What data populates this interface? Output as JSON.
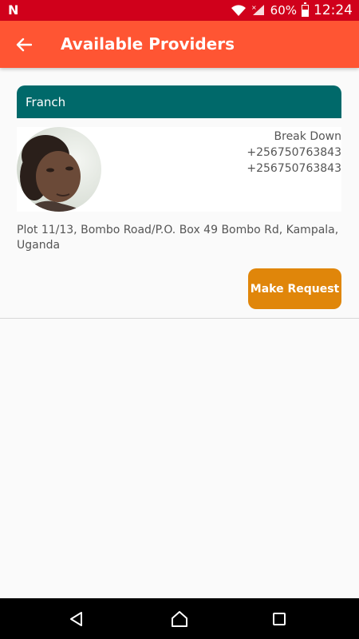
{
  "status_bar": {
    "notification_icon": "N",
    "battery_percent": "60%",
    "battery_level": 0.6,
    "time": "12:24"
  },
  "app_bar": {
    "title": "Available Providers",
    "back_icon": "arrow-left"
  },
  "provider": {
    "name": "Franch",
    "service": "Break Down",
    "phone_1": "+256750763843",
    "phone_2": "+256750763843",
    "address": "Plot 11/13, Bombo Road/P.O. Box 49 Bombo Rd, Kampala, Uganda",
    "request_button": "Make Request"
  },
  "colors": {
    "status_bar": "#d0001b",
    "app_bar": "#ff5533",
    "provider_header": "#00696a",
    "request_button": "#e0860a"
  }
}
